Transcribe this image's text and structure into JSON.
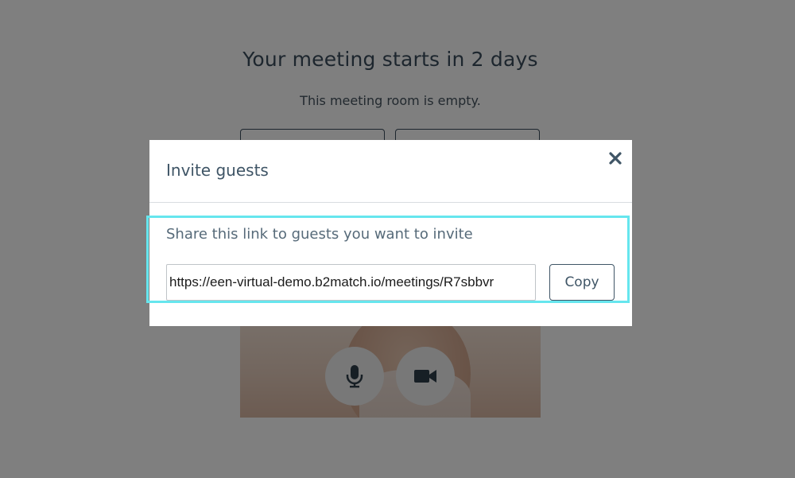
{
  "page": {
    "title": "Your meeting starts in 2 days",
    "subtitle": "This meeting room is empty."
  },
  "controls": {
    "mic_icon": "microphone-icon",
    "cam_icon": "video-camera-icon"
  },
  "modal": {
    "title": "Invite guests",
    "close_icon": "close-icon",
    "share_text": "Share this link to guests you want to invite",
    "link_value": "https://een-virtual-demo.b2match.io/meetings/R7sbbvr",
    "copy_label": "Copy"
  },
  "colors": {
    "overlay": "#000000",
    "highlight": "#66e6ee",
    "heading": "#3a4c5c"
  }
}
